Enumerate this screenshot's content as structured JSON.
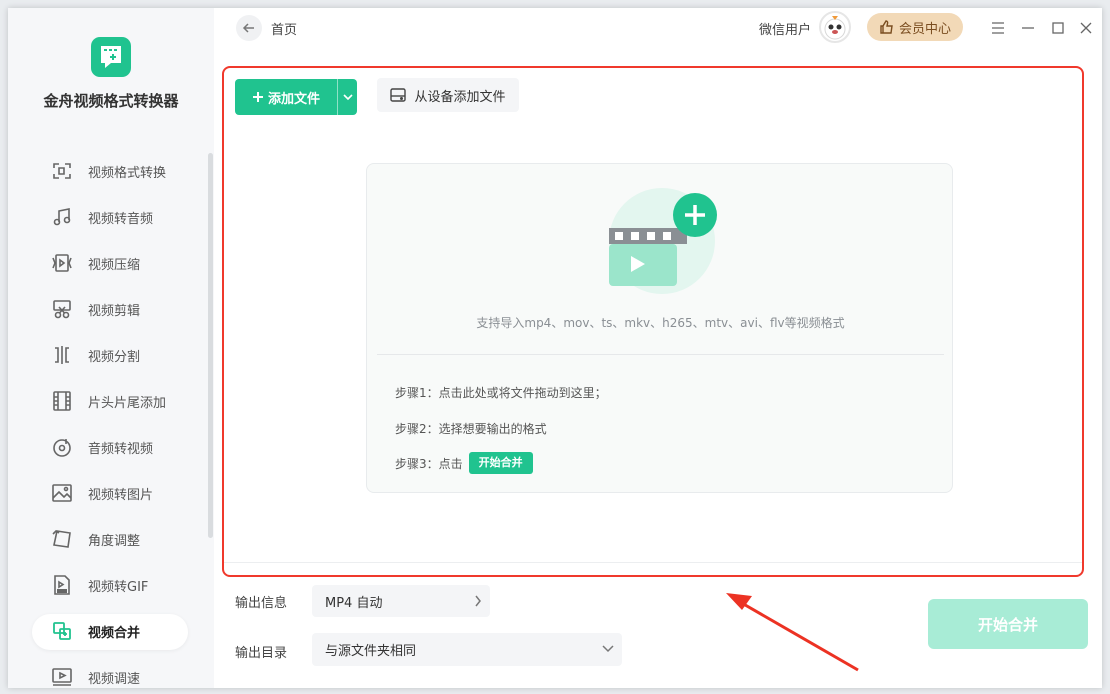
{
  "app": {
    "name": "金舟视频格式转换器"
  },
  "sidebar": {
    "items": [
      {
        "label": "视频格式转换",
        "icon": "format-convert-icon"
      },
      {
        "label": "视频转音频",
        "icon": "music-note-icon"
      },
      {
        "label": "视频压缩",
        "icon": "compress-icon"
      },
      {
        "label": "视频剪辑",
        "icon": "scissors-icon"
      },
      {
        "label": "视频分割",
        "icon": "split-icon"
      },
      {
        "label": "片头片尾添加",
        "icon": "film-strip-icon"
      },
      {
        "label": "音频转视频",
        "icon": "disc-icon"
      },
      {
        "label": "视频转图片",
        "icon": "image-icon"
      },
      {
        "label": "角度调整",
        "icon": "rotate-icon"
      },
      {
        "label": "视频转GIF",
        "icon": "gif-icon"
      },
      {
        "label": "视频合并",
        "icon": "merge-icon",
        "active": true
      },
      {
        "label": "视频调速",
        "icon": "speed-icon"
      }
    ]
  },
  "header": {
    "breadcrumb": "首页",
    "user_name": "微信用户",
    "vip_label": "会员中心"
  },
  "toolbar": {
    "add_file": "添加文件",
    "add_from_device": "从设备添加文件"
  },
  "dropzone": {
    "support_text": "支持导入mp4、mov、ts、mkv、h265、mtv、avi、flv等视频格式",
    "step1": "步骤1：点击此处或将文件拖动到这里；",
    "step2": "步骤2：选择想要输出的格式",
    "step3": "步骤3：点击",
    "step3_badge": "开始合并"
  },
  "output": {
    "info_label": "输出信息",
    "info_value": "MP4 自动",
    "dir_label": "输出目录",
    "dir_value": "与源文件夹相同"
  },
  "start_button": "开始合并",
  "colors": {
    "accent": "#20c38f",
    "highlight_border": "#f0392c",
    "vip": "#f2d9b7"
  }
}
